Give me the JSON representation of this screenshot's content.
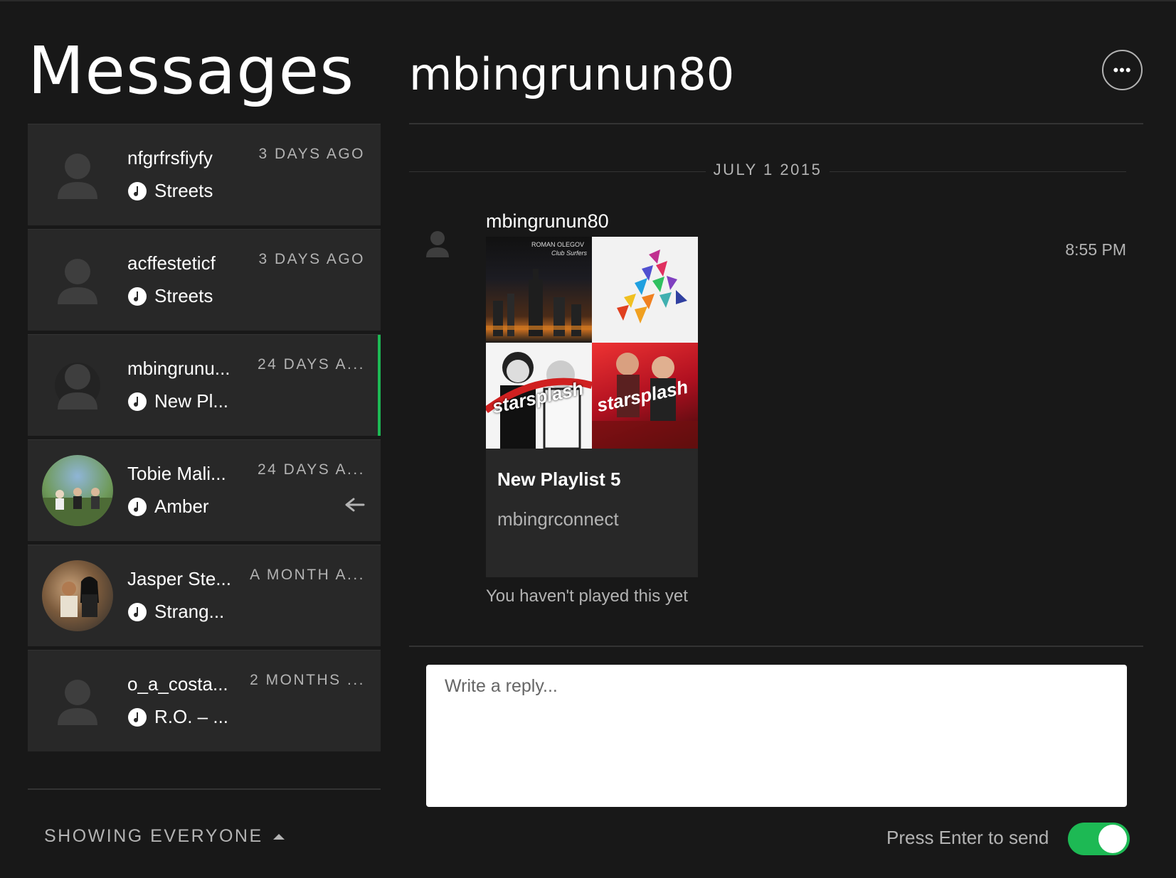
{
  "left": {
    "title": "Messages",
    "conversations": [
      {
        "name": "nfgrfrsfiyfy",
        "track": "Streets",
        "time": "3 DAYS AGO",
        "avatar": "default-user-icon"
      },
      {
        "name": "acffesteticf",
        "track": "Streets",
        "time": "3 DAYS AGO",
        "avatar": "default-user-icon"
      },
      {
        "name": "mbingrunu...",
        "track": "New Pl...",
        "time": "24 DAYS A...",
        "avatar": "default-user-icon",
        "selected": true
      },
      {
        "name": "Tobie Mali...",
        "track": "Amber",
        "time": "24 DAYS A...",
        "avatar": "photo",
        "reply_icon": "reply-arrow-icon"
      },
      {
        "name": "Jasper Ste...",
        "track": "Strang...",
        "time": "A MONTH A...",
        "avatar": "photo"
      },
      {
        "name": "o_a_costa...",
        "track": "R.O. – ...",
        "time": "2 MONTHS ...",
        "avatar": "default-user-icon"
      }
    ],
    "filter_label": "SHOWING EVERYONE"
  },
  "chat": {
    "title": "mbingrunun80",
    "date_separator": "JULY 1 2015",
    "message": {
      "sender": "mbingrunun80",
      "time": "8:55 PM",
      "playlist": {
        "title": "New Playlist 5",
        "owner": "mbingrconnect",
        "cover_texts": [
          "ROMAN OLEGOV",
          "Club Surfers",
          "starsplash",
          "starsplash"
        ]
      },
      "status": "You haven't played this yet"
    },
    "reply_placeholder": "Write a reply...",
    "enter_to_send_label": "Press Enter to send",
    "enter_to_send_enabled": true
  },
  "colors": {
    "background": "#181818",
    "panel": "#282828",
    "accent": "#1db954",
    "muted_text": "#b3b3b3"
  }
}
